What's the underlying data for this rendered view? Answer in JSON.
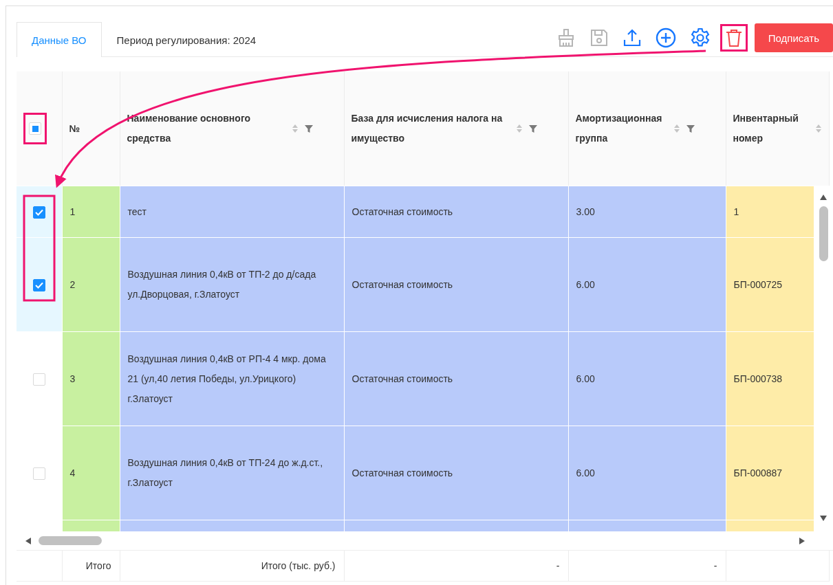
{
  "tabs": [
    {
      "label": "Данные ВО",
      "selected": true
    },
    {
      "label": "Период регулирования: 2024",
      "selected": false
    }
  ],
  "toolbar": {
    "tools": [
      {
        "kind": "broom",
        "disabled": true,
        "highlighted": false
      },
      {
        "kind": "save",
        "disabled": true,
        "highlighted": false
      },
      {
        "kind": "upload",
        "disabled": false,
        "highlighted": false
      },
      {
        "kind": "add",
        "disabled": false,
        "highlighted": false
      },
      {
        "kind": "settings",
        "disabled": false,
        "highlighted": false
      },
      {
        "kind": "delete",
        "disabled": false,
        "highlighted": true
      }
    ],
    "sign_button": "Подписать"
  },
  "table": {
    "select_all": {
      "indeterminate": true,
      "highlighted": true
    },
    "columns": [
      {
        "label": "№",
        "sortable": false,
        "filterable": false,
        "color": "#c8f0a0"
      },
      {
        "label": "Наименование основного средства",
        "sortable": true,
        "filterable": true,
        "color": "#b8cafa"
      },
      {
        "label": "База для исчисления налога на имущество",
        "sortable": true,
        "filterable": true,
        "color": "#b8cafa"
      },
      {
        "label": "Амортизационная группа",
        "sortable": true,
        "filterable": true,
        "color": "#b8cafa"
      },
      {
        "label": "Инвентарный номер",
        "sortable": true,
        "filterable": false,
        "color": "#feeca8"
      }
    ],
    "rows": [
      {
        "selected": true,
        "cells": [
          "1",
          "тест",
          "Остаточная стоимость",
          "3.00",
          "1"
        ]
      },
      {
        "selected": true,
        "cells": [
          "2",
          "Воздушная линия 0,4кВ от ТП-2 до д/сада ул.Дворцовая, г.Златоуст",
          "Остаточная стоимость",
          "6.00",
          "БП-000725"
        ]
      },
      {
        "selected": false,
        "cells": [
          "3",
          "Воздушная линия 0,4кВ от РП-4 4 мкр. дома 21 (ул,40 летия Победы, ул.Урицкого) г.Златоуст",
          "Остаточная стоимость",
          "6.00",
          "БП-000738"
        ]
      },
      {
        "selected": false,
        "cells": [
          "4",
          "Воздушная линия 0,4кВ от ТП-24 до ж.д.ст., г.Златоуст",
          "Остаточная стоимость",
          "6.00",
          "БП-000887"
        ]
      }
    ],
    "footer": [
      "Итого",
      "Итого (тыс. руб.)",
      "-",
      "-"
    ]
  }
}
